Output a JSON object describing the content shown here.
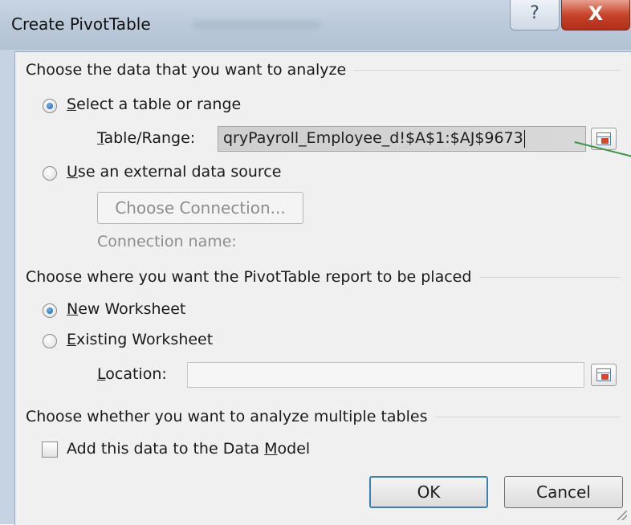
{
  "window": {
    "title": "Create PivotTable",
    "help_glyph": "?",
    "close_glyph": "X"
  },
  "analyze_section": {
    "heading": "Choose the data that you want to analyze",
    "select_table_label_first": "S",
    "select_table_label_rest": "elect a table or range",
    "select_table_checked": true,
    "table_range_label_first": "T",
    "table_range_label_rest": "able/Range:",
    "table_range_value": "qryPayroll_Employee_d!$A$1:$AJ$9673",
    "external_source_label_first": "U",
    "external_source_label_rest": "se an external data source",
    "external_source_checked": false,
    "choose_connection_button": "Choose Connection...",
    "connection_name_label": "Connection name:"
  },
  "placement_section": {
    "heading": "Choose where you want the PivotTable report to be placed",
    "new_worksheet_first": "N",
    "new_worksheet_rest": "ew Worksheet",
    "new_worksheet_checked": true,
    "existing_worksheet_first": "E",
    "existing_worksheet_rest": "xisting Worksheet",
    "existing_worksheet_checked": false,
    "location_label_first": "L",
    "location_label_rest": "ocation:",
    "location_value": ""
  },
  "multiple_tables_section": {
    "heading": "Choose whether you want to analyze multiple tables",
    "data_model_label_before": "Add this data to the Data ",
    "data_model_label_under": "M",
    "data_model_label_after": "odel",
    "data_model_checked": false
  },
  "footer": {
    "ok_label": "OK",
    "cancel_label": "Cancel"
  },
  "colors": {
    "title_bar": "#bccadb",
    "dialog_bg": "#f0f0f0",
    "close_red": "#c8432b",
    "default_button_border": "#3c7fb1",
    "annotation_green": "#3b9447"
  }
}
